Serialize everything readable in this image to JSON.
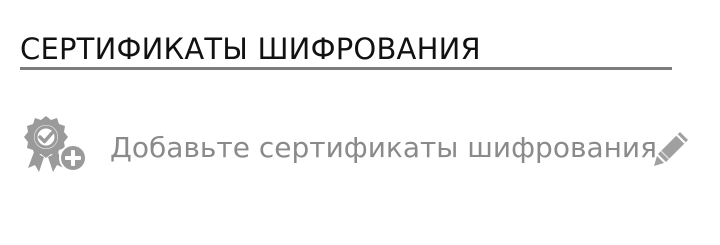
{
  "section": {
    "title": "СЕРТИФИКАТЫ ШИФРОВАНИЯ"
  },
  "add_certificate": {
    "label": "Добавьте сертификаты шифрования",
    "icon": "certificate-add-icon",
    "action_icon": "pencil-icon"
  },
  "colors": {
    "title_text": "#111111",
    "rule": "#7c7c7c",
    "muted_text": "#8a8a8a",
    "icon_gray": "#9a9a9a",
    "background": "#ffffff"
  }
}
